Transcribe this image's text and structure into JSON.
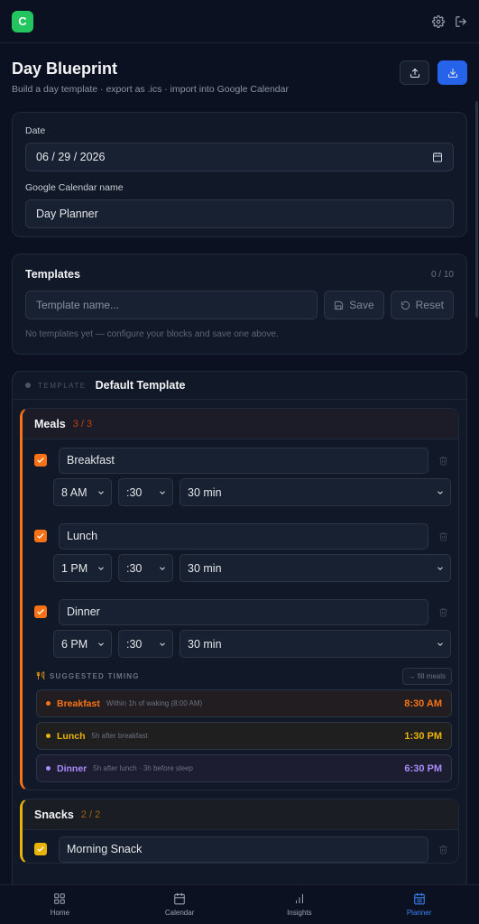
{
  "app": {
    "logo_letter": "C"
  },
  "header": {
    "title": "Day Blueprint",
    "subtitle": "Build a day template · export as .ics · import into Google Calendar"
  },
  "settings": {
    "date_label": "Date",
    "date_value": "06 / 29 / 2026",
    "calendar_name_label": "Google Calendar name",
    "calendar_name_value": "Day Planner"
  },
  "templates": {
    "title": "Templates",
    "count": "0 / 10",
    "name_placeholder": "Template name...",
    "save_label": "Save",
    "reset_label": "Reset",
    "empty_text": "No templates yet — configure your blocks and save one above."
  },
  "template": {
    "tag": "TEMPLATE",
    "name": "Default Template"
  },
  "meals": {
    "title": "Meals",
    "count": "3 / 3",
    "items": [
      {
        "name": "Breakfast",
        "hour": "8 AM",
        "minute": ":30",
        "duration": "30 min",
        "checked": true
      },
      {
        "name": "Lunch",
        "hour": "1 PM",
        "minute": ":30",
        "duration": "30 min",
        "checked": true
      },
      {
        "name": "Dinner",
        "hour": "6 PM",
        "minute": ":30",
        "duration": "30 min",
        "checked": true
      }
    ],
    "suggested": {
      "title": "SUGGESTED TIMING",
      "fill_label": "→ fill meals",
      "rows": [
        {
          "name": "Breakfast",
          "note": "Within 1h of waking (8:00 AM)",
          "time": "8:30 AM"
        },
        {
          "name": "Lunch",
          "note": "5h after breakfast",
          "time": "1:30 PM"
        },
        {
          "name": "Dinner",
          "note": "5h after lunch · 3h before sleep",
          "time": "6:30 PM"
        }
      ]
    }
  },
  "snacks": {
    "title": "Snacks",
    "count": "2 / 2",
    "items": [
      {
        "name": "Morning Snack",
        "checked": true
      }
    ]
  },
  "nav": {
    "items": [
      {
        "label": "Home",
        "icon": "grid-icon"
      },
      {
        "label": "Calendar",
        "icon": "calendar-icon"
      },
      {
        "label": "Insights",
        "icon": "bar-chart-icon"
      },
      {
        "label": "Planner",
        "icon": "calendar-icon",
        "active": true
      }
    ]
  },
  "colors": {
    "accent": "#2563eb",
    "meals": "#f97316",
    "snacks": "#eab308",
    "dinner": "#a78bfa"
  }
}
